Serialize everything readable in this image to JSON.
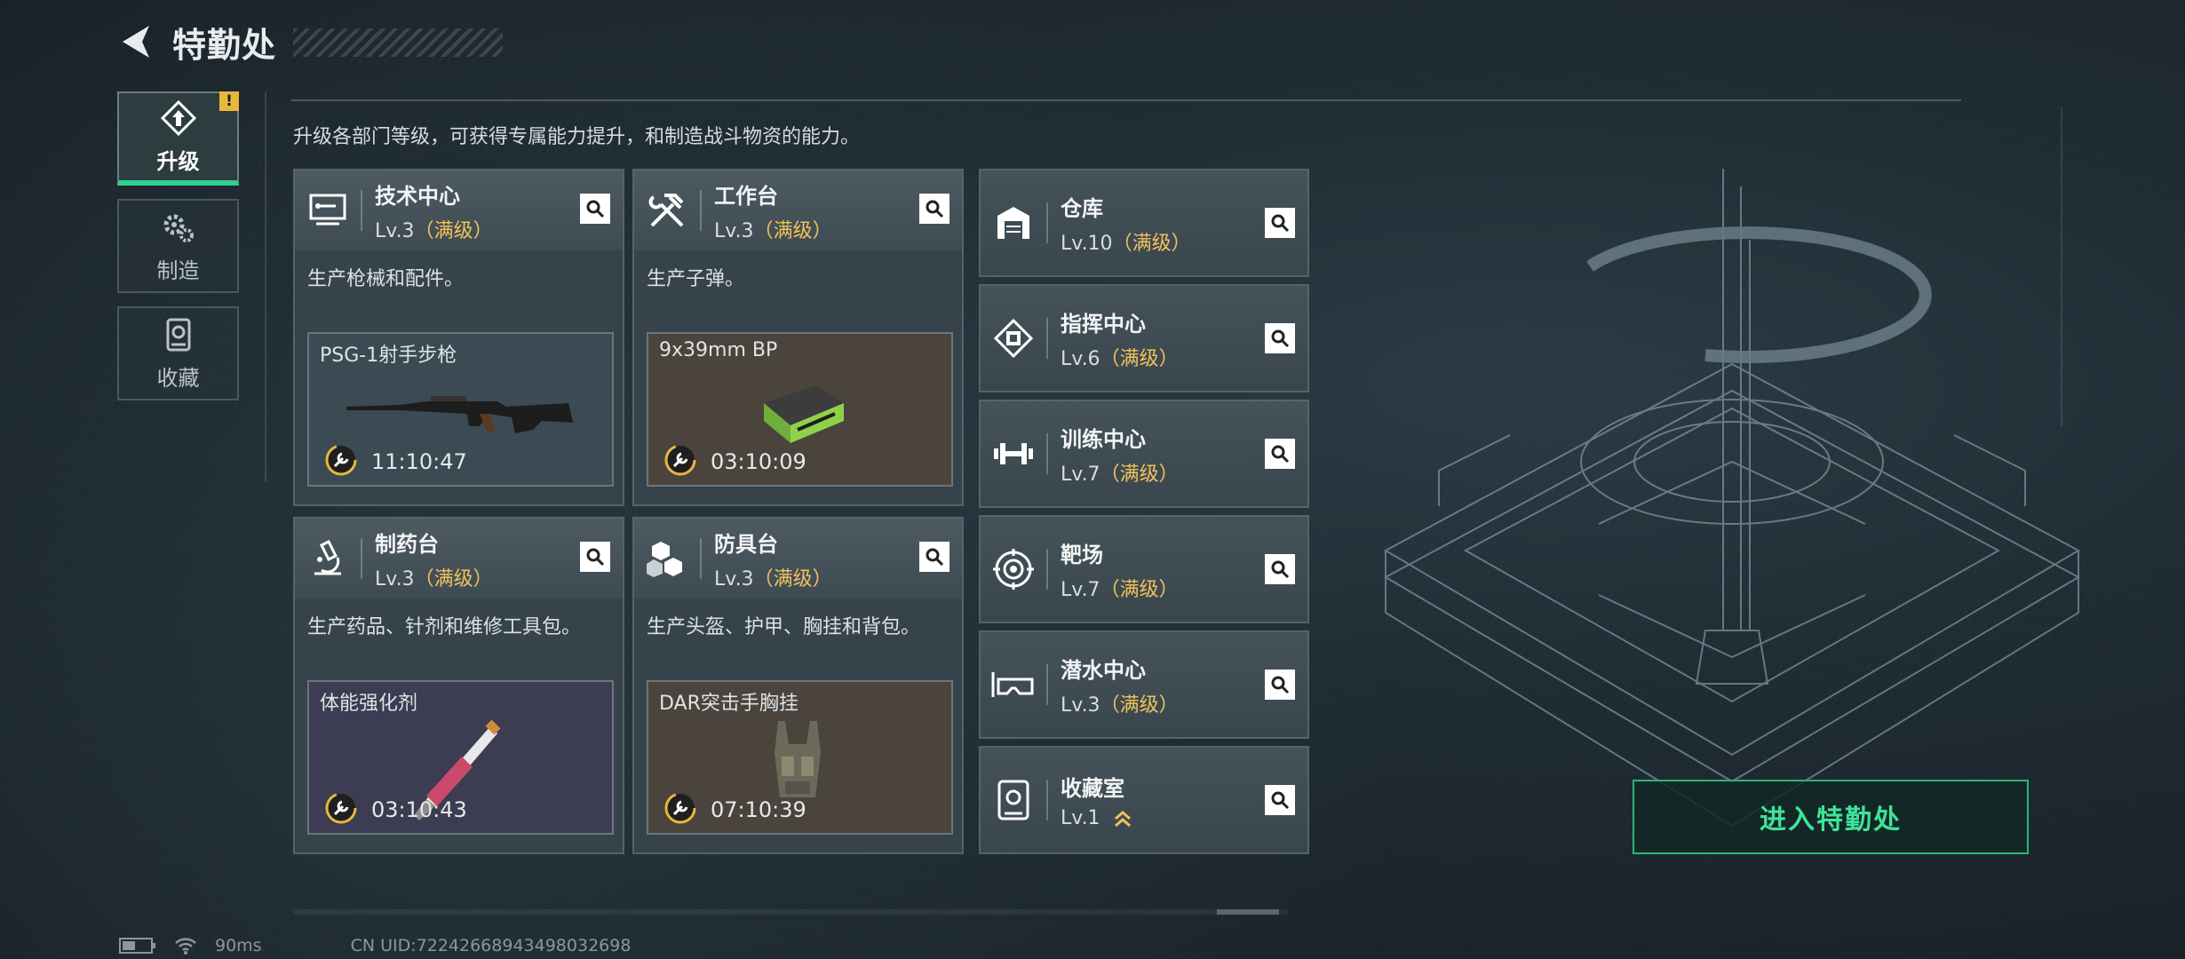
{
  "header": {
    "title": "特勤处"
  },
  "sidebar": {
    "tabs": [
      {
        "label": "升级",
        "icon": "upgrade-icon",
        "active": true,
        "badge": "!"
      },
      {
        "label": "制造",
        "icon": "gears-icon",
        "active": false
      },
      {
        "label": "收藏",
        "icon": "collection-icon",
        "active": false
      }
    ]
  },
  "description": "升级各部门等级，可获得专属能力提升，和制造战斗物资的能力。",
  "workshops": [
    {
      "name": "技术中心",
      "level": "Lv.3",
      "status": "（满级）",
      "desc": "生产枪械和配件。",
      "product": "PSG-1射手步枪",
      "time": "11:10:47",
      "icon": "computer-icon"
    },
    {
      "name": "工作台",
      "level": "Lv.3",
      "status": "（满级）",
      "desc": "生产子弹。",
      "product": "9x39mm BP",
      "time": "03:10:09",
      "icon": "tools-icon"
    },
    {
      "name": "制药台",
      "level": "Lv.3",
      "status": "（满级）",
      "desc": "生产药品、针剂和维修工具包。",
      "product": "体能强化剂",
      "time": "03:10:43",
      "icon": "microscope-icon"
    },
    {
      "name": "防具台",
      "level": "Lv.3",
      "status": "（满级）",
      "desc": "生产头盔、护甲、胸挂和背包。",
      "product": "DAR突击手胸挂",
      "time": "07:10:39",
      "icon": "armor-boxes-icon"
    }
  ],
  "facilities": [
    {
      "name": "仓库",
      "level": "Lv.10",
      "status": "（满级）",
      "icon": "warehouse-icon"
    },
    {
      "name": "指挥中心",
      "level": "Lv.6",
      "status": "（满级）",
      "icon": "command-chip-icon"
    },
    {
      "name": "训练中心",
      "level": "Lv.7",
      "status": "（满级）",
      "icon": "dumbbell-icon"
    },
    {
      "name": "靶场",
      "level": "Lv.7",
      "status": "（满级）",
      "icon": "target-icon"
    },
    {
      "name": "潜水中心",
      "level": "Lv.3",
      "status": "（满级）",
      "icon": "diving-mask-icon"
    },
    {
      "name": "收藏室",
      "level": "Lv.1",
      "status": "",
      "icon": "collection-room-icon",
      "upgradable": true
    }
  ],
  "enter_button": "进入特勤处",
  "status_bar": {
    "ping": "90ms",
    "uid": "CN UID:72242668943498032698"
  },
  "colors": {
    "accent": "#3ee39a",
    "max_level": "#f0c25a",
    "warning": "#e8b83a"
  }
}
